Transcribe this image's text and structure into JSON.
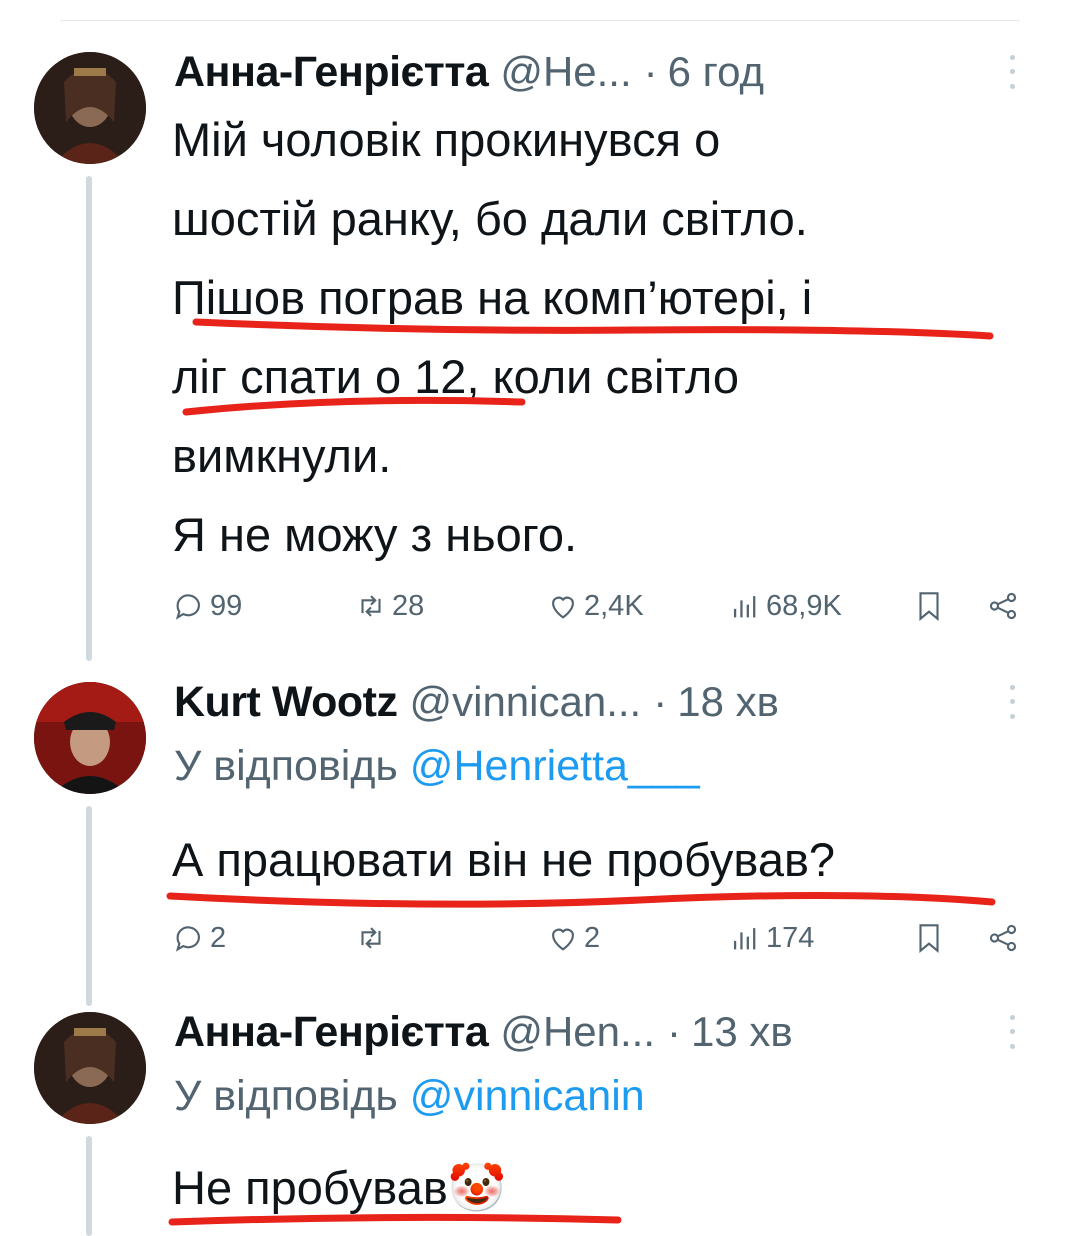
{
  "tweets": [
    {
      "name": "Анна-Генрієтта",
      "handle": "@He...",
      "time": "6 год",
      "body": "Мій чоловік прокинувся о\nшостій ранку, бо дали світло.\nПішов пограв на комп’ютері, і\nліг спати о 12, коли світло\nвимкнули.\nЯ не можу з нього.",
      "replies": "99",
      "retweets": "28",
      "likes": "2,4K",
      "views": "68,9K"
    },
    {
      "name": "Kurt Wootz",
      "handle": "@vinnican...",
      "time": "18 хв",
      "reply_prefix": "У відповідь ",
      "reply_to": "@Henrietta___",
      "body": "А працювати він не пробував?",
      "replies": "2",
      "retweets": "",
      "likes": "2",
      "views": "174"
    },
    {
      "name": "Анна-Генрієтта",
      "handle": "@Hen...",
      "time": "13 хв",
      "reply_prefix": "У відповідь ",
      "reply_to": "@vinnicanin",
      "body": "Не пробував🤡"
    }
  ],
  "colors": {
    "accent": "#1d9bf0",
    "text": "#0f1419",
    "muted": "#536471",
    "annotation": "#e8231a"
  },
  "icons": [
    "reply-icon",
    "retweet-icon",
    "like-icon",
    "views-icon",
    "bookmark-icon",
    "share-icon",
    "more-icon"
  ]
}
